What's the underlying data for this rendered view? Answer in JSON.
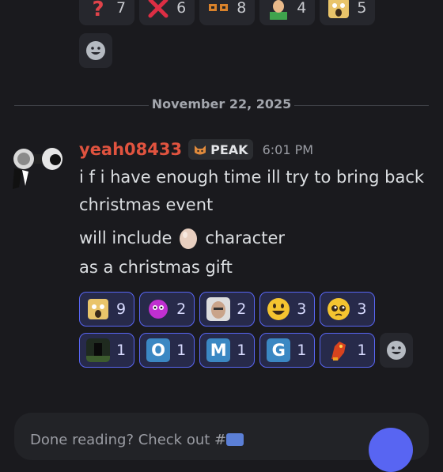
{
  "top_reactions": [
    {
      "name": "question-emoji",
      "count": "7"
    },
    {
      "name": "red-x-emoji",
      "count": "6"
    },
    {
      "name": "glasses-emoji",
      "count": "8"
    },
    {
      "name": "baldi-emoji",
      "count": "4"
    },
    {
      "name": "shocked-face-emoji",
      "count": "5"
    }
  ],
  "date_divider": "November 22, 2025",
  "message": {
    "username": "yeah08433",
    "tag": "PEAK",
    "time": "6:01 PM",
    "line1": "i f i have enough time ill try to bring back",
    "line2": "christmas event",
    "line3a": "will include",
    "line3b": "character",
    "line4": "as a christmas gift"
  },
  "reactions_row1": [
    {
      "name": "shocked-face-emoji",
      "count": "9"
    },
    {
      "name": "pink-creature-emoji",
      "count": "2"
    },
    {
      "name": "old-man-emoji",
      "count": "2"
    },
    {
      "name": "grinning-face-emoji",
      "count": "3"
    },
    {
      "name": "pleading-face-emoji",
      "count": "3"
    }
  ],
  "reactions_row2": [
    {
      "name": "dark-figure-emoji",
      "count": "1",
      "letter": ""
    },
    {
      "name": "letter-o-emoji",
      "count": "1",
      "letter": "O"
    },
    {
      "name": "letter-m-emoji",
      "count": "1",
      "letter": "M"
    },
    {
      "name": "letter-g-emoji",
      "count": "1",
      "letter": "G"
    },
    {
      "name": "red-fox-emoji",
      "count": "1",
      "letter": ""
    }
  ],
  "input_placeholder": "Done reading? Check out #",
  "colors": {
    "username": "#e0533f",
    "accent": "#5865f2",
    "background": "#1a1a1e"
  }
}
